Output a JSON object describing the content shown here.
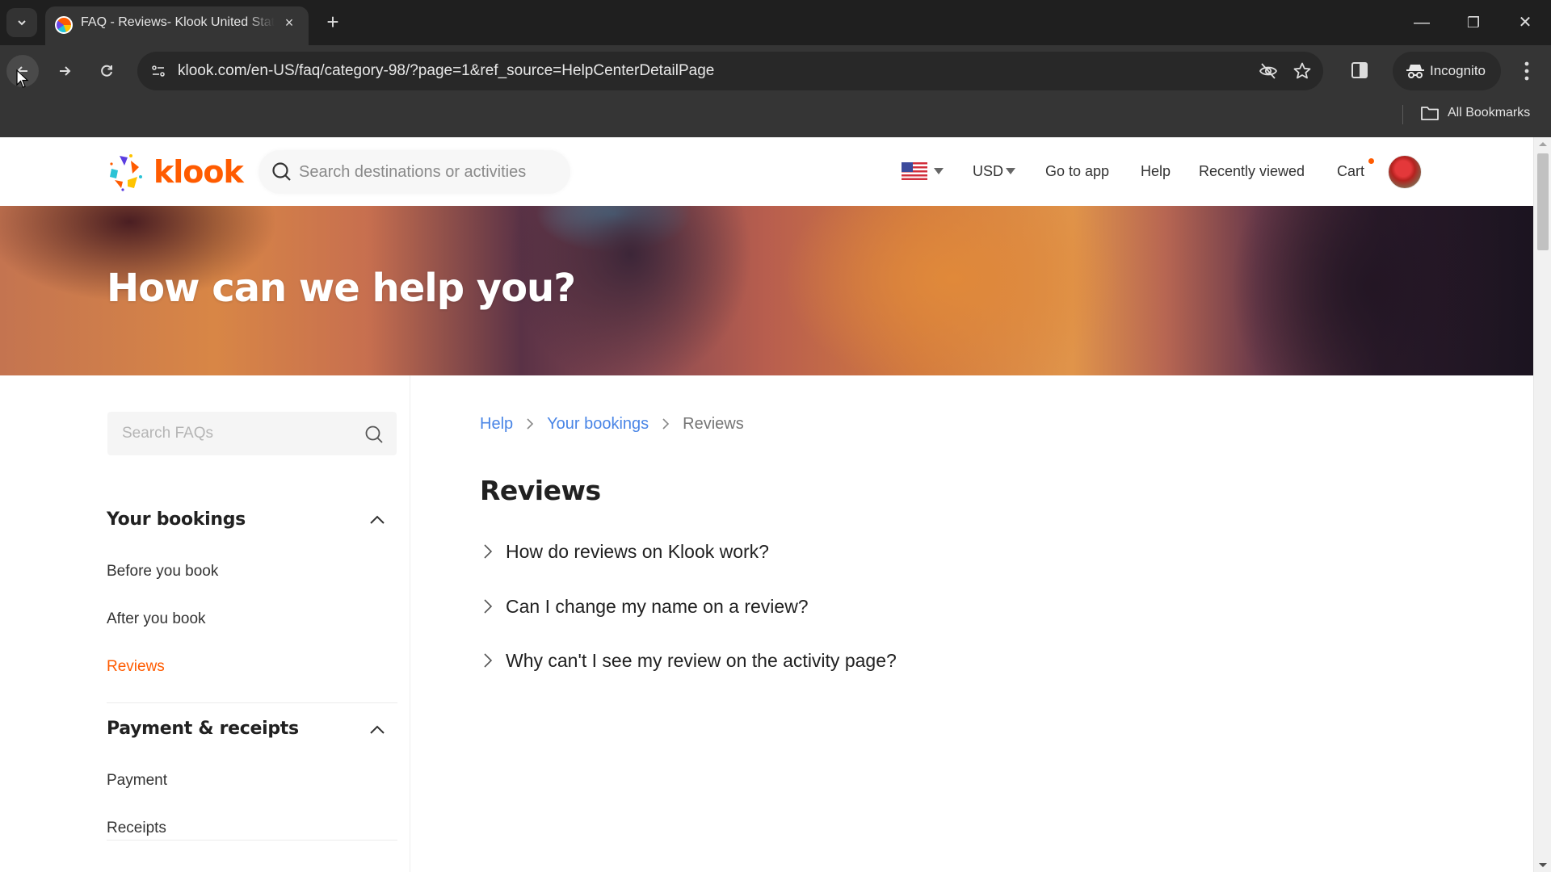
{
  "browser": {
    "tab": {
      "title": "FAQ - Reviews- Klook United States",
      "close_label": "×"
    },
    "new_tab_label": "+",
    "url": "klook.com/en-US/faq/category-98/?page=1&ref_source=HelpCenterDetailPage",
    "incognito_label": "Incognito",
    "all_bookmarks_label": "All Bookmarks",
    "window_controls": {
      "minimize": "—",
      "restore": "❐",
      "close": "✕"
    }
  },
  "site": {
    "brand": {
      "name": "klook",
      "color": "#ff5b00"
    },
    "search": {
      "placeholder": "Search destinations or activities",
      "value": ""
    },
    "nav": {
      "locale_flag": "us-flag",
      "currency": "USD",
      "go_to_app": "Go to app",
      "help": "Help",
      "recently_viewed": "Recently viewed",
      "cart": "Cart"
    }
  },
  "hero": {
    "title": "How can we help you?"
  },
  "sidebar": {
    "search": {
      "placeholder": "Search FAQs",
      "value": ""
    },
    "groups": [
      {
        "title": "Your bookings",
        "expanded": true,
        "items": [
          {
            "label": "Before you book",
            "active": false
          },
          {
            "label": "After you book",
            "active": false
          },
          {
            "label": "Reviews",
            "active": true
          }
        ]
      },
      {
        "title": "Payment & receipts",
        "expanded": true,
        "items": [
          {
            "label": "Payment",
            "active": false
          },
          {
            "label": "Receipts",
            "active": false
          }
        ]
      }
    ]
  },
  "main": {
    "breadcrumb": [
      {
        "label": "Help",
        "link": true
      },
      {
        "label": "Your bookings",
        "link": true
      },
      {
        "label": "Reviews",
        "link": false
      }
    ],
    "title": "Reviews",
    "questions": [
      "How do reviews on Klook work?",
      "Can I change my name on a review?",
      "Why can't I see my review on the activity page?"
    ]
  },
  "colors": {
    "accent": "#ff5b00",
    "link": "#4985e6",
    "text": "#212121",
    "chrome_dark": "#1f1f1f",
    "chrome_toolbar": "#353535"
  }
}
